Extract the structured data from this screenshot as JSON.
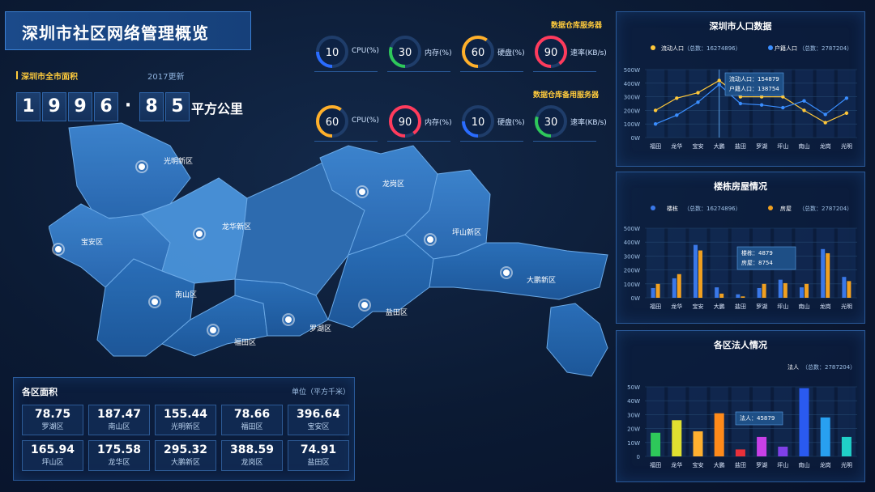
{
  "page_title": "深圳市社区网络管理概览",
  "total_area": {
    "label": "深圳市全市面积",
    "update": "2017更新",
    "digits": [
      "1",
      "9",
      "9",
      "6",
      "·",
      "8",
      "5"
    ],
    "unit": "平方公里"
  },
  "servers": [
    {
      "title": "数据仓库服务器",
      "gauges": [
        {
          "value": "10",
          "label": "CPU(%)",
          "color": "#2a6cff",
          "pct": 0.1
        },
        {
          "value": "30",
          "label": "内存(%)",
          "color": "#2ec85a",
          "pct": 0.3
        },
        {
          "value": "60",
          "label": "硬盘(%)",
          "color": "#ffb02a",
          "pct": 0.6
        },
        {
          "value": "90",
          "label": "速率(KB/s)",
          "color": "#ff3b5c",
          "pct": 0.9
        }
      ]
    },
    {
      "title": "数据仓库备用服务器",
      "gauges": [
        {
          "value": "60",
          "label": "CPU(%)",
          "color": "#ffb02a",
          "pct": 0.6
        },
        {
          "value": "90",
          "label": "内存(%)",
          "color": "#ff3b5c",
          "pct": 0.9
        },
        {
          "value": "10",
          "label": "硬盘(%)",
          "color": "#2a6cff",
          "pct": 0.1
        },
        {
          "value": "30",
          "label": "速率(KB/s)",
          "color": "#2ec85a",
          "pct": 0.3
        }
      ]
    }
  ],
  "map": {
    "districts": [
      {
        "name": "光明新区"
      },
      {
        "name": "宝安区"
      },
      {
        "name": "龙华新区"
      },
      {
        "name": "南山区"
      },
      {
        "name": "福田区"
      },
      {
        "name": "罗湖区"
      },
      {
        "name": "盐田区"
      },
      {
        "name": "龙岗区"
      },
      {
        "name": "坪山新区"
      },
      {
        "name": "大鹏新区"
      }
    ]
  },
  "areas": {
    "title": "各区面积",
    "unit": "单位（平方千米）",
    "items": [
      {
        "value": "78.75",
        "name": "罗湖区"
      },
      {
        "value": "187.47",
        "name": "南山区"
      },
      {
        "value": "155.44",
        "name": "光明新区"
      },
      {
        "value": "78.66",
        "name": "福田区"
      },
      {
        "value": "396.64",
        "name": "宝安区"
      },
      {
        "value": "165.94",
        "name": "坪山区"
      },
      {
        "value": "175.58",
        "name": "龙华区"
      },
      {
        "value": "295.32",
        "name": "大鹏新区"
      },
      {
        "value": "388.59",
        "name": "龙岗区"
      },
      {
        "value": "74.91",
        "name": "盐田区"
      }
    ]
  },
  "chart_data": [
    {
      "type": "line",
      "title": "深圳市人口数据",
      "legend": [
        "流动人口",
        "（总数：16274896）",
        "户籍人口",
        "（总数：2787204）"
      ],
      "categories": [
        "福田",
        "龙华",
        "宝安",
        "大鹏",
        "盐田",
        "罗湖",
        "坪山",
        "南山",
        "龙岗",
        "光明"
      ],
      "y_ticks": [
        "0W",
        "100W",
        "200W",
        "300W",
        "400W",
        "500W"
      ],
      "ylim": [
        0,
        500
      ],
      "series": [
        {
          "name": "流动人口",
          "color": "#ffc83a",
          "values": [
            200,
            290,
            330,
            420,
            300,
            300,
            300,
            200,
            110,
            180
          ]
        },
        {
          "name": "户籍人口",
          "color": "#3a8eff",
          "values": [
            100,
            165,
            260,
            390,
            250,
            240,
            220,
            270,
            170,
            290
          ]
        }
      ],
      "tooltip": [
        "流动人口：154879",
        "户籍人口：138754"
      ]
    },
    {
      "type": "bar",
      "title": "楼栋房屋情况",
      "legend": [
        "楼栋",
        "（总数：16274896）",
        "房屋",
        "（总数：2787204）"
      ],
      "categories": [
        "福田",
        "龙华",
        "宝安",
        "大鹏",
        "盐田",
        "罗湖",
        "坪山",
        "南山",
        "龙岗",
        "光明"
      ],
      "y_ticks": [
        "0W",
        "100W",
        "200W",
        "300W",
        "400W",
        "500W"
      ],
      "ylim": [
        0,
        500
      ],
      "series": [
        {
          "name": "楼栋",
          "color": "#3a78e8",
          "values": [
            70,
            140,
            380,
            75,
            25,
            70,
            130,
            75,
            350,
            150
          ]
        },
        {
          "name": "房屋",
          "color": "#f0a020",
          "values": [
            100,
            170,
            340,
            30,
            10,
            100,
            105,
            100,
            320,
            120
          ]
        }
      ],
      "tooltip": [
        "楼栋：4879",
        "房屋：8754"
      ]
    },
    {
      "type": "bar",
      "title": "各区法人情况",
      "legend": [
        "法人",
        "（总数：2787204）"
      ],
      "categories": [
        "福田",
        "龙华",
        "宝安",
        "大鹏",
        "盐田",
        "罗湖",
        "坪山",
        "南山",
        "龙岗",
        "光明"
      ],
      "y_ticks": [
        "0",
        "10W",
        "20W",
        "30W",
        "40W",
        "50W"
      ],
      "ylim": [
        0,
        50
      ],
      "series": [
        {
          "name": "法人",
          "values": [
            17,
            26,
            18,
            31,
            5,
            14,
            7,
            49,
            28,
            14
          ]
        }
      ],
      "bar_colors": [
        "#2ec85a",
        "#e0e030",
        "#ffb030",
        "#ff8a1a",
        "#e8303a",
        "#c840e8",
        "#8040e8",
        "#2a5af0",
        "#28a0f0",
        "#20d0c8"
      ],
      "tooltip": [
        "法人：45879"
      ]
    }
  ]
}
